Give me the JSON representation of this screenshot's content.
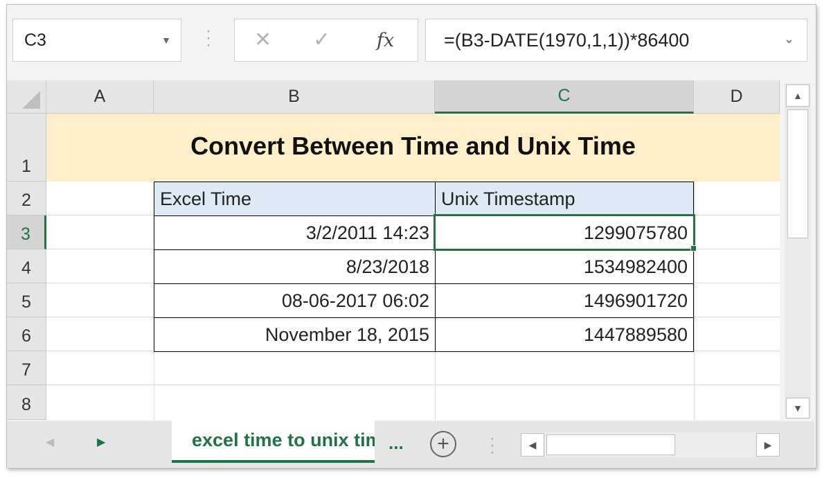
{
  "formula_bar": {
    "name_box": "C3",
    "cancel_icon": "✕",
    "enter_icon": "✓",
    "fx_label": "fx",
    "formula": "=(B3-DATE(1970,1,1))*86400"
  },
  "columns": [
    "A",
    "B",
    "C",
    "D"
  ],
  "selected_column": "C",
  "rows": [
    "1",
    "2",
    "3",
    "4",
    "5",
    "6",
    "7",
    "8"
  ],
  "selected_row": "3",
  "sheet": {
    "title": "Convert Between Time and Unix Time",
    "table": {
      "headers": [
        "Excel Time",
        "Unix Timestamp"
      ],
      "rows": [
        [
          "3/2/2011 14:23",
          "1299075780"
        ],
        [
          "8/23/2018",
          "1534982400"
        ],
        [
          "08-06-2017 06:02",
          "1496901720"
        ],
        [
          "November 18, 2015",
          "1447889580"
        ]
      ]
    }
  },
  "active_cell": "C3",
  "tabs": {
    "sheet_tab_label": "excel time to unix time",
    "more_label": "...",
    "add_sheet_icon": "+"
  },
  "colors": {
    "accent": "#217346",
    "title_fill": "#fdefc9",
    "header_fill": "#dde9f5"
  }
}
